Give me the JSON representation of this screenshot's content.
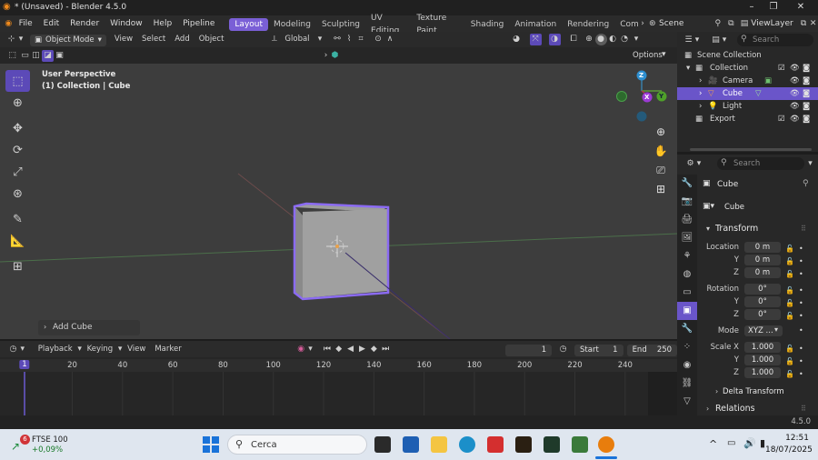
{
  "titlebar": {
    "title": "* (Unsaved) - Blender 4.5.0"
  },
  "menu": {
    "items": [
      "File",
      "Edit",
      "Render",
      "Window",
      "Help",
      "Pipeline"
    ]
  },
  "workspaces": [
    "Layout",
    "Modeling",
    "Sculpting",
    "UV Editing",
    "Texture Paint",
    "Shading",
    "Animation",
    "Rendering",
    "Compo"
  ],
  "scene": {
    "label": "Scene"
  },
  "viewlayer": {
    "label": "ViewLayer"
  },
  "view3d": {
    "mode": "Object Mode",
    "menus": [
      "View",
      "Select",
      "Add",
      "Object"
    ],
    "orientation": "Global",
    "options": "Options",
    "perspective": "User Perspective",
    "collection_info": "(1) Collection | Cube",
    "last_op": "Add Cube",
    "gizmo": {
      "z": "Z",
      "x": "X",
      "y": "Y"
    }
  },
  "timeline": {
    "menus": [
      "Playback",
      "Keying",
      "View",
      "Marker"
    ],
    "current_frame": "1",
    "start_label": "Start",
    "start": "1",
    "end_label": "End",
    "end": "250",
    "ticks": [
      "1",
      "20",
      "40",
      "60",
      "80",
      "100",
      "120",
      "140",
      "160",
      "180",
      "200",
      "220",
      "240"
    ]
  },
  "status": {
    "version": "4.5.0"
  },
  "outliner": {
    "search_placeholder": "Search",
    "rows": [
      {
        "label": "Scene Collection"
      },
      {
        "label": "Collection"
      },
      {
        "label": "Camera"
      },
      {
        "label": "Cube"
      },
      {
        "label": "Light"
      },
      {
        "label": "Export"
      }
    ]
  },
  "properties": {
    "search_placeholder": "Search",
    "object_name": "Cube",
    "data_name": "Cube",
    "transform": "Transform",
    "location_label": "Location",
    "location": [
      "0 m",
      "0 m",
      "0 m"
    ],
    "rotation_label": "Rotation",
    "rotation": [
      "0°",
      "0°",
      "0°"
    ],
    "mode_label": "Mode",
    "mode_value": "XYZ ...",
    "scale_label": "Scale X",
    "scale": [
      "1.000",
      "1.000",
      "1.000"
    ],
    "axis_y": "Y",
    "axis_z": "Z",
    "delta": "Delta Transform",
    "relations": "Relations"
  },
  "taskbar": {
    "stock_name": "FTSE 100",
    "stock_change": "+0,09%",
    "badge": "6",
    "search": "Cerca",
    "time": "12:51",
    "date": "18/07/2025"
  },
  "colors": {
    "accent": "#7a5fd6",
    "selection": "#6a55c9"
  }
}
